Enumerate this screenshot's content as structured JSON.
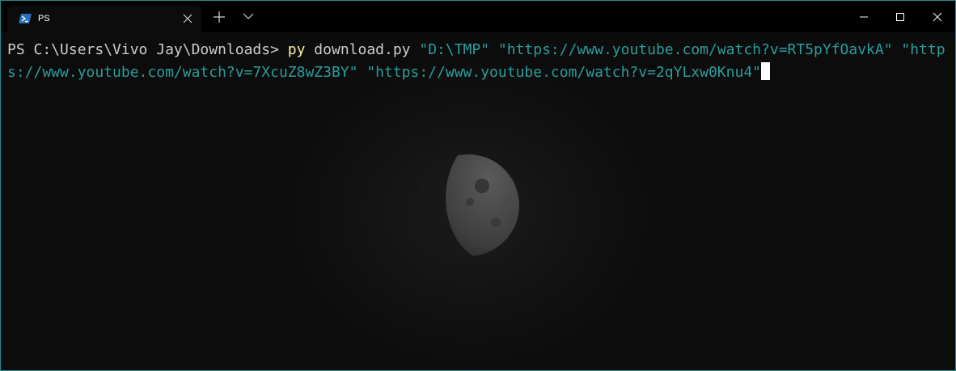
{
  "tab": {
    "title": "PS",
    "icon": "powershell-icon"
  },
  "titlebar": {
    "new_tab_icon": "plus-icon",
    "dropdown_icon": "chevron-down-icon",
    "minimize_icon": "minimize-icon",
    "maximize_icon": "maximize-icon",
    "close_icon": "close-icon"
  },
  "terminal": {
    "prompt": "PS C:\\Users\\Vivo Jay\\Downloads> ",
    "command": "py",
    "script": " download.py ",
    "args": [
      "\"D:\\TMP\"",
      "\"https://www.youtube.com/watch?v=RT5pYfOavkA\"",
      "\"https://www.youtube.com/watch?v=7XcuZ8wZ3BY\"",
      "\"https://www.youtube.com/watch?v=2qYLxw0Knu4\""
    ],
    "background_image": "moon-image"
  },
  "colors": {
    "border": "#2b8a8f",
    "terminal_bg": "#0c0c0c",
    "titlebar_bg": "#000000",
    "prompt_text": "#cccccc",
    "command_text": "#f9f1a5",
    "string_text": "#2a9d9c"
  }
}
